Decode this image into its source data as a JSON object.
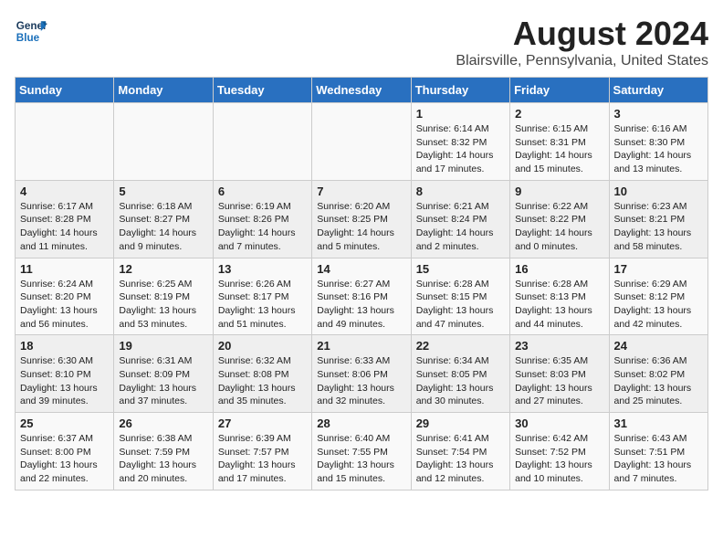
{
  "logo": {
    "line1": "General",
    "line2": "Blue"
  },
  "title": "August 2024",
  "subtitle": "Blairsville, Pennsylvania, United States",
  "days_of_week": [
    "Sunday",
    "Monday",
    "Tuesday",
    "Wednesday",
    "Thursday",
    "Friday",
    "Saturday"
  ],
  "weeks": [
    [
      {
        "day": "",
        "content": ""
      },
      {
        "day": "",
        "content": ""
      },
      {
        "day": "",
        "content": ""
      },
      {
        "day": "",
        "content": ""
      },
      {
        "day": "1",
        "content": "Sunrise: 6:14 AM\nSunset: 8:32 PM\nDaylight: 14 hours\nand 17 minutes."
      },
      {
        "day": "2",
        "content": "Sunrise: 6:15 AM\nSunset: 8:31 PM\nDaylight: 14 hours\nand 15 minutes."
      },
      {
        "day": "3",
        "content": "Sunrise: 6:16 AM\nSunset: 8:30 PM\nDaylight: 14 hours\nand 13 minutes."
      }
    ],
    [
      {
        "day": "4",
        "content": "Sunrise: 6:17 AM\nSunset: 8:28 PM\nDaylight: 14 hours\nand 11 minutes."
      },
      {
        "day": "5",
        "content": "Sunrise: 6:18 AM\nSunset: 8:27 PM\nDaylight: 14 hours\nand 9 minutes."
      },
      {
        "day": "6",
        "content": "Sunrise: 6:19 AM\nSunset: 8:26 PM\nDaylight: 14 hours\nand 7 minutes."
      },
      {
        "day": "7",
        "content": "Sunrise: 6:20 AM\nSunset: 8:25 PM\nDaylight: 14 hours\nand 5 minutes."
      },
      {
        "day": "8",
        "content": "Sunrise: 6:21 AM\nSunset: 8:24 PM\nDaylight: 14 hours\nand 2 minutes."
      },
      {
        "day": "9",
        "content": "Sunrise: 6:22 AM\nSunset: 8:22 PM\nDaylight: 14 hours\nand 0 minutes."
      },
      {
        "day": "10",
        "content": "Sunrise: 6:23 AM\nSunset: 8:21 PM\nDaylight: 13 hours\nand 58 minutes."
      }
    ],
    [
      {
        "day": "11",
        "content": "Sunrise: 6:24 AM\nSunset: 8:20 PM\nDaylight: 13 hours\nand 56 minutes."
      },
      {
        "day": "12",
        "content": "Sunrise: 6:25 AM\nSunset: 8:19 PM\nDaylight: 13 hours\nand 53 minutes."
      },
      {
        "day": "13",
        "content": "Sunrise: 6:26 AM\nSunset: 8:17 PM\nDaylight: 13 hours\nand 51 minutes."
      },
      {
        "day": "14",
        "content": "Sunrise: 6:27 AM\nSunset: 8:16 PM\nDaylight: 13 hours\nand 49 minutes."
      },
      {
        "day": "15",
        "content": "Sunrise: 6:28 AM\nSunset: 8:15 PM\nDaylight: 13 hours\nand 47 minutes."
      },
      {
        "day": "16",
        "content": "Sunrise: 6:28 AM\nSunset: 8:13 PM\nDaylight: 13 hours\nand 44 minutes."
      },
      {
        "day": "17",
        "content": "Sunrise: 6:29 AM\nSunset: 8:12 PM\nDaylight: 13 hours\nand 42 minutes."
      }
    ],
    [
      {
        "day": "18",
        "content": "Sunrise: 6:30 AM\nSunset: 8:10 PM\nDaylight: 13 hours\nand 39 minutes."
      },
      {
        "day": "19",
        "content": "Sunrise: 6:31 AM\nSunset: 8:09 PM\nDaylight: 13 hours\nand 37 minutes."
      },
      {
        "day": "20",
        "content": "Sunrise: 6:32 AM\nSunset: 8:08 PM\nDaylight: 13 hours\nand 35 minutes."
      },
      {
        "day": "21",
        "content": "Sunrise: 6:33 AM\nSunset: 8:06 PM\nDaylight: 13 hours\nand 32 minutes."
      },
      {
        "day": "22",
        "content": "Sunrise: 6:34 AM\nSunset: 8:05 PM\nDaylight: 13 hours\nand 30 minutes."
      },
      {
        "day": "23",
        "content": "Sunrise: 6:35 AM\nSunset: 8:03 PM\nDaylight: 13 hours\nand 27 minutes."
      },
      {
        "day": "24",
        "content": "Sunrise: 6:36 AM\nSunset: 8:02 PM\nDaylight: 13 hours\nand 25 minutes."
      }
    ],
    [
      {
        "day": "25",
        "content": "Sunrise: 6:37 AM\nSunset: 8:00 PM\nDaylight: 13 hours\nand 22 minutes."
      },
      {
        "day": "26",
        "content": "Sunrise: 6:38 AM\nSunset: 7:59 PM\nDaylight: 13 hours\nand 20 minutes."
      },
      {
        "day": "27",
        "content": "Sunrise: 6:39 AM\nSunset: 7:57 PM\nDaylight: 13 hours\nand 17 minutes."
      },
      {
        "day": "28",
        "content": "Sunrise: 6:40 AM\nSunset: 7:55 PM\nDaylight: 13 hours\nand 15 minutes."
      },
      {
        "day": "29",
        "content": "Sunrise: 6:41 AM\nSunset: 7:54 PM\nDaylight: 13 hours\nand 12 minutes."
      },
      {
        "day": "30",
        "content": "Sunrise: 6:42 AM\nSunset: 7:52 PM\nDaylight: 13 hours\nand 10 minutes."
      },
      {
        "day": "31",
        "content": "Sunrise: 6:43 AM\nSunset: 7:51 PM\nDaylight: 13 hours\nand 7 minutes."
      }
    ]
  ]
}
